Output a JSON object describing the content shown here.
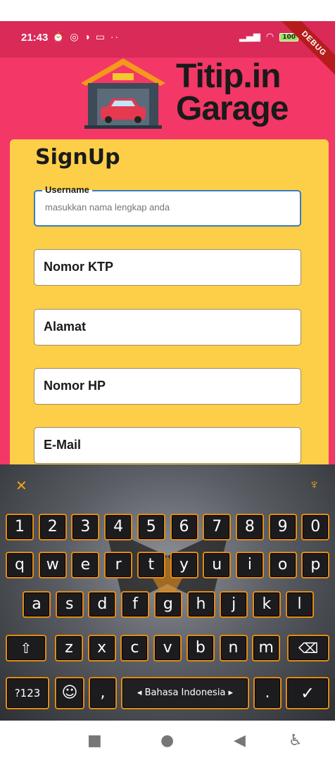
{
  "status": {
    "time": "21:43",
    "left_icons": "⏰ ◎ ◑ ▭ ··",
    "battery": "100",
    "debug": "DEBUG"
  },
  "logo": {
    "line1": "Titip.in",
    "line2": "Garage"
  },
  "form": {
    "title": "SignUp",
    "username_label": "Username",
    "username_placeholder": "masukkan nama lengkap anda",
    "fields": [
      "Nomor KTP",
      "Alamat",
      "Nomor HP",
      "E-Mail"
    ]
  },
  "keyboard": {
    "row_numbers": [
      "1",
      "2",
      "3",
      "4",
      "5",
      "6",
      "7",
      "8",
      "9",
      "0"
    ],
    "row1": [
      "q",
      "w",
      "e",
      "r",
      "t",
      "y",
      "u",
      "i",
      "o",
      "p"
    ],
    "row2": [
      "a",
      "s",
      "d",
      "f",
      "g",
      "h",
      "j",
      "k",
      "l"
    ],
    "row3": [
      "z",
      "x",
      "c",
      "v",
      "b",
      "n",
      "m"
    ],
    "shift": "⇧",
    "backspace": "⌫",
    "symbols": "?123",
    "emoji": "☺",
    "comma": ",",
    "space": "◂ Bahasa Indonesia ▸",
    "period": ".",
    "enter": "✓"
  },
  "navbar": {
    "square": "■",
    "home": "●",
    "back": "◀",
    "accessibility": "♿"
  }
}
